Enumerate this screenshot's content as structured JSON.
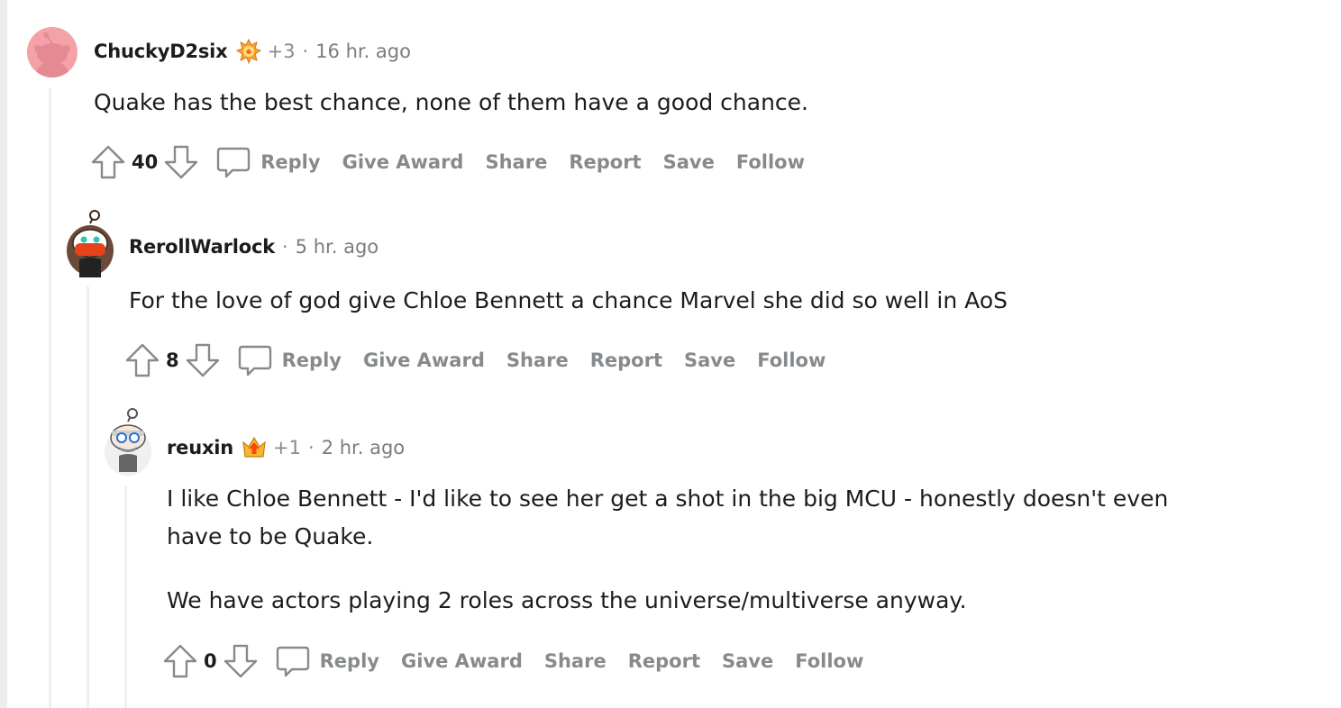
{
  "comments": [
    {
      "username": "ChuckyD2six",
      "award_count": "+3",
      "time": "16 hr. ago",
      "body": [
        "Quake has the best chance, none of them have a good chance."
      ],
      "votes": "40",
      "avatar_icon": "snoo-default-avatar",
      "flair_icon": "flaming-award-icon"
    },
    {
      "username": "RerollWarlock",
      "award_count": "",
      "time": "5 hr. ago",
      "body": [
        "For the love of god give Chloe Bennett a chance Marvel she did so well in AoS"
      ],
      "votes": "8",
      "avatar_icon": "snoo-red-mask-avatar"
    },
    {
      "username": "reuxin",
      "award_count": "+1",
      "time": "2 hr. ago",
      "body": [
        "I like Chloe Bennett - I'd like to see her get a shot in the big MCU - honestly doesn't even",
        "have to be Quake.",
        "We have actors playing 2 roles across the universe/multiverse anyway."
      ],
      "votes": "0",
      "avatar_icon": "snoo-glasses-avatar",
      "flair_icon": "upvote-award-icon"
    }
  ],
  "actions": {
    "reply": "Reply",
    "give_award": "Give Award",
    "share": "Share",
    "report": "Report",
    "save": "Save",
    "follow": "Follow"
  },
  "separator": "·",
  "colors": {
    "muted": "#878a8c",
    "thread_line": "#edeff1",
    "default_avatar_bg": "#f4a2a8"
  }
}
